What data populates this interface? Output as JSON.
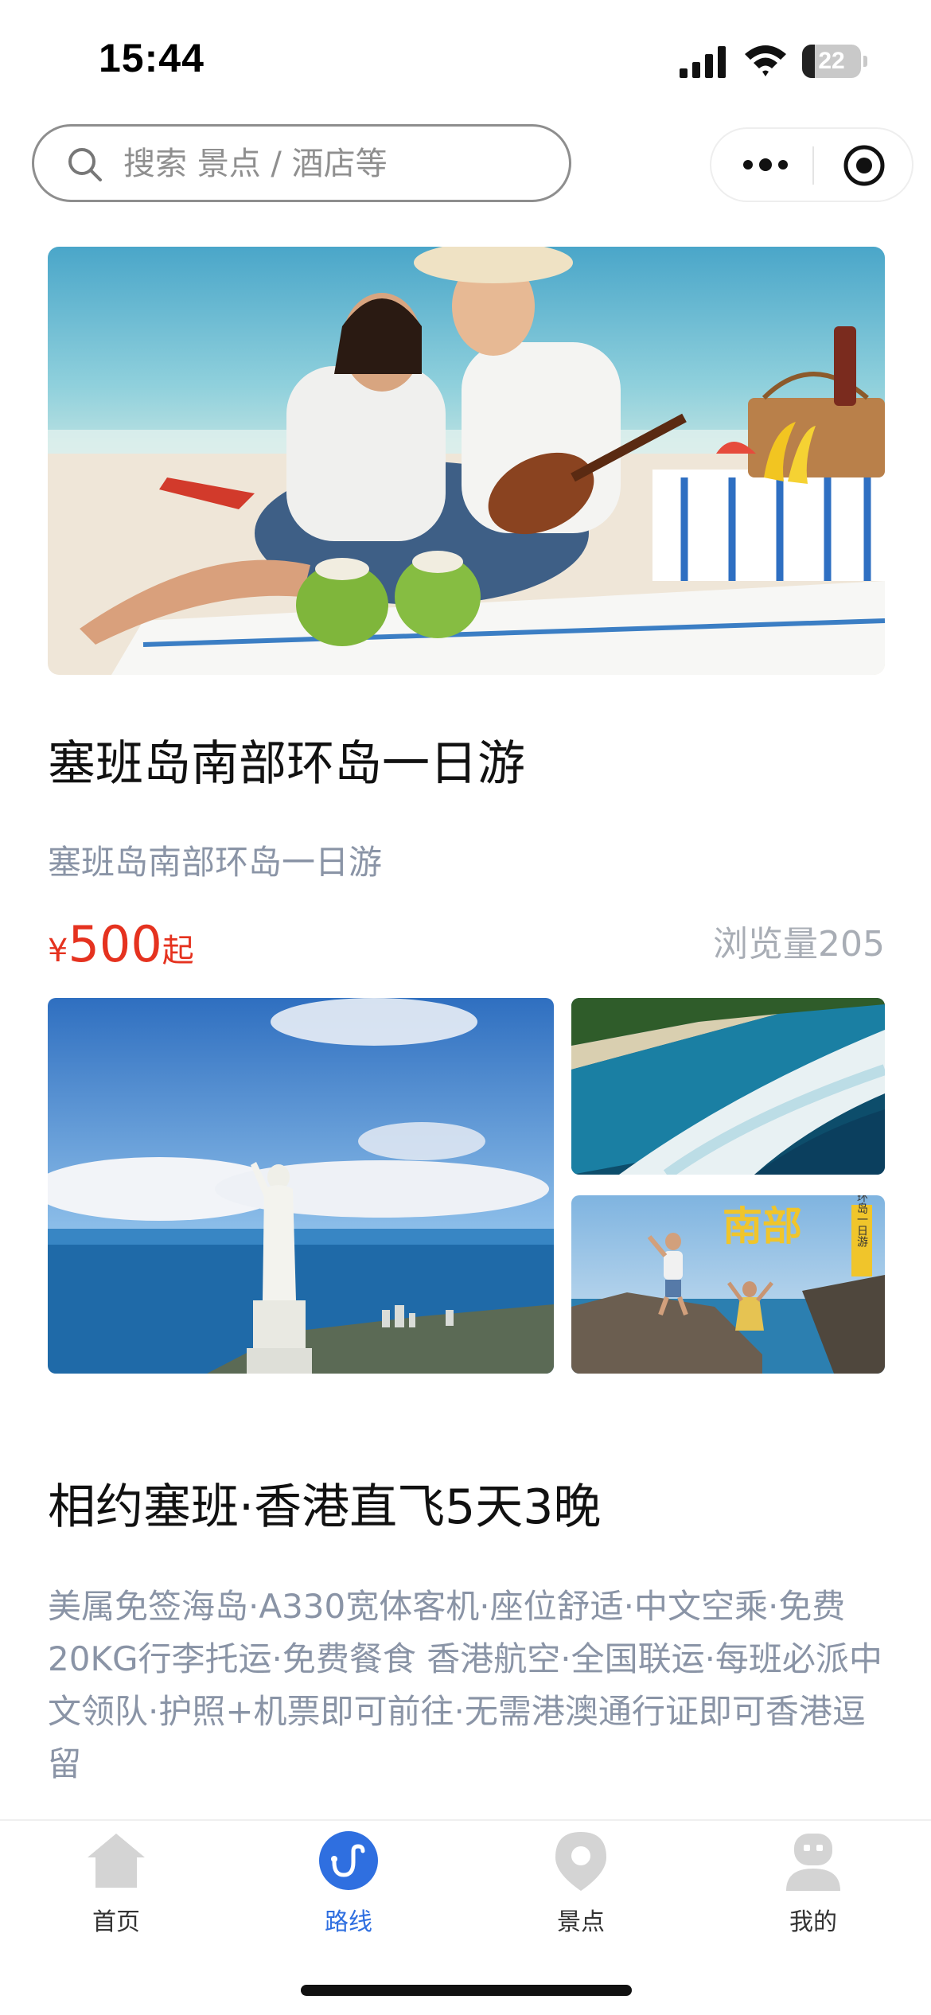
{
  "status_bar": {
    "time": "15:44",
    "battery": "22",
    "battery_level": 0.22,
    "icons": [
      "signal-icon",
      "wifi-icon",
      "battery-icon"
    ]
  },
  "search": {
    "placeholder": "搜索 景点 / 酒店等",
    "icon": "search-icon"
  },
  "capsule": {
    "icons": [
      "more-icon",
      "target-icon"
    ]
  },
  "feed": {
    "cards": [
      {
        "title": "塞班岛南部环岛一日游",
        "subtitle": "塞班岛南部环岛一日游",
        "price_currency": "¥",
        "price_amount": "500",
        "price_suffix": "起",
        "views": "浏览量205"
      },
      {
        "title": "相约塞班·香港直飞5天3晚",
        "description": "美属免签海岛·A330宽体客机·座位舒适·中文空乘·免费20KG行李托运·免费餐食 香港航空·全国联运·每班必派中文领队·护照+机票即可前往·无需港澳通行证即可香港逗留"
      }
    ],
    "gallery_badge": {
      "big": "南部",
      "small": "环岛一日游"
    }
  },
  "tab_bar": {
    "items": [
      {
        "label": "首页",
        "icon": "home-icon",
        "active": false
      },
      {
        "label": "路线",
        "icon": "route-icon",
        "active": true
      },
      {
        "label": "景点",
        "icon": "location-pin-icon",
        "active": false
      },
      {
        "label": "我的",
        "icon": "profile-icon",
        "active": false
      }
    ]
  },
  "colors": {
    "price": "#e5321f",
    "active_tab": "#2f6fe0",
    "muted_text": "#8a94a6",
    "inactive_icon": "#d4d4d4"
  }
}
